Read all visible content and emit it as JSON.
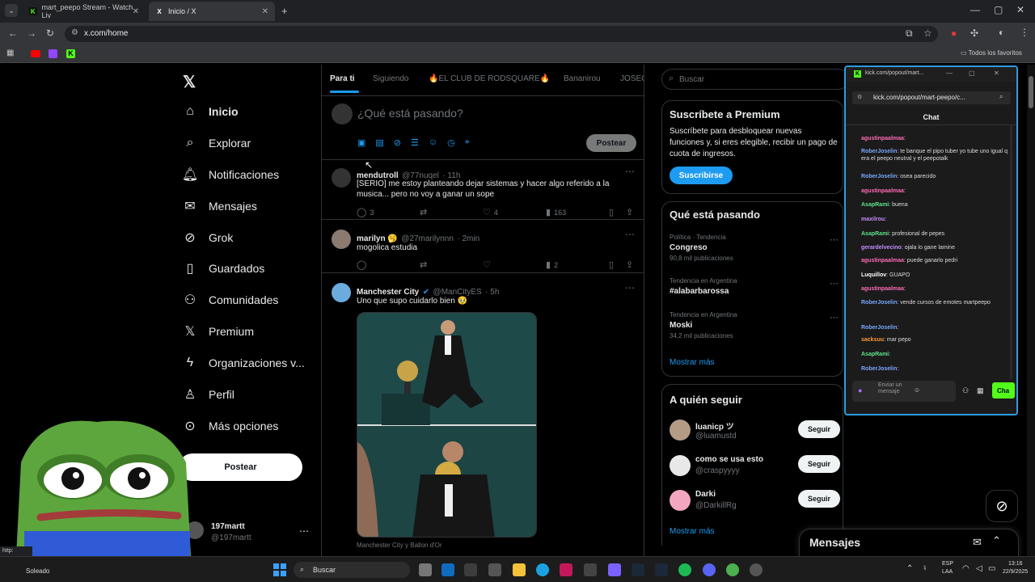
{
  "browser": {
    "tabs": [
      {
        "title": "mart_peepo Stream - Watch Liv",
        "favicon": "K",
        "favicon_color": "#53fc18"
      },
      {
        "title": "Inicio / X",
        "favicon": "X",
        "favicon_color": "#ffffff"
      }
    ],
    "url": "x.com/home",
    "bookmarks_label": "Todos los favoritos",
    "status_url": "http:"
  },
  "nav": {
    "items": [
      {
        "label": "Inicio",
        "icon": "home-icon"
      },
      {
        "label": "Explorar",
        "icon": "search-icon"
      },
      {
        "label": "Notificaciones",
        "icon": "bell-icon"
      },
      {
        "label": "Mensajes",
        "icon": "mail-icon"
      },
      {
        "label": "Grok",
        "icon": "grok-icon"
      },
      {
        "label": "Guardados",
        "icon": "bookmark-icon"
      },
      {
        "label": "Comunidades",
        "icon": "people-icon"
      },
      {
        "label": "Premium",
        "icon": "x-logo-icon"
      },
      {
        "label": "Organizaciones v...",
        "icon": "lightning-icon"
      },
      {
        "label": "Perfil",
        "icon": "person-icon"
      },
      {
        "label": "Más opciones",
        "icon": "more-circle-icon"
      }
    ],
    "post_button": "Postear",
    "account": {
      "name": "197martt",
      "handle": "@197martt"
    }
  },
  "feed": {
    "tabs": [
      "Para ti",
      "Siguiendo",
      "🔥EL CLUB DE RODSQUARE🔥",
      "Bananirou",
      "JOSEC"
    ],
    "compose_placeholder": "¿Qué está pasando?",
    "compose_post": "Postear",
    "tweets": [
      {
        "name": "mendutroll",
        "handle": "@77nuqel",
        "time": "· 11h",
        "text": "[SERIO] me estoy planteando dejar sistemas y hacer algo referido a la musica... pero no voy a ganar un sope",
        "replies": "3",
        "likes": "4",
        "views": "163"
      },
      {
        "name": "marilyn 🥱",
        "handle": "@27marilynnn",
        "time": "· 2min",
        "text": "mogolica estudia",
        "replies": "",
        "likes": "",
        "views": "2"
      },
      {
        "name": "Manchester City",
        "handle": "@ManCityES",
        "time": "· 5h",
        "text": "Uno que supo cuidarlo bien 🥹",
        "caption": "Manchester City y Ballon d'Or"
      }
    ]
  },
  "right": {
    "search_placeholder": "Buscar",
    "premium": {
      "title": "Suscríbete a Premium",
      "body": "Suscríbete para desbloquear nuevas funciones y, si eres elegible, recibir un pago de cuota de ingresos.",
      "button": "Suscribirse"
    },
    "trends": {
      "title": "Qué está pasando",
      "items": [
        {
          "context": "Política · Tendencia",
          "topic": "Congreso",
          "count": "90,8 mil publicaciones"
        },
        {
          "context": "Tendencia en Argentina",
          "topic": "#alabarbarossa",
          "count": ""
        },
        {
          "context": "Tendencia en Argentina",
          "topic": "Moski",
          "count": "34,2 mil publicaciones"
        }
      ],
      "more": "Mostrar más"
    },
    "follow": {
      "title": "A quién seguir",
      "items": [
        {
          "name": "luanicp ツ",
          "handle": "@luamustd",
          "button": "Seguir"
        },
        {
          "name": "como se usa esto",
          "handle": "@craspyyyy",
          "button": "Seguir"
        },
        {
          "name": "Darki",
          "handle": "@DarkillRg",
          "button": "Seguir"
        }
      ],
      "more": "Mostrar más"
    },
    "messages_drawer": "Mensajes"
  },
  "kick": {
    "window_title": "kick.com/popout/mart...",
    "url": "kick.com/popout/mart-peepo/c...",
    "header": "Chat",
    "lines": [
      {
        "user": "agustinpaalmaa",
        "color": "#ff6bb5",
        "msg": ":"
      },
      {
        "user": "RoberJoselin",
        "color": "#7aa7ff",
        "msg": ": te banque el pipo tuber yo tube uno igual q era el peepo neutral y el peepotalk"
      },
      {
        "user": "RoberJoselin",
        "color": "#7aa7ff",
        "msg": ": osea parecido"
      },
      {
        "user": "agustinpaalmaa",
        "color": "#ff6bb5",
        "msg": ":"
      },
      {
        "user": "AsapRami",
        "color": "#5ee38a",
        "msg": ": buena"
      },
      {
        "user": "maxilrou",
        "color": "#c78bff",
        "msg": ":"
      },
      {
        "user": "AsapRami",
        "color": "#5ee38a",
        "msg": ": profesional de pepes"
      },
      {
        "user": "gerardelvecino",
        "color": "#c78bff",
        "msg": ": ojala lo gane lamine"
      },
      {
        "user": "agustinpaalmaa",
        "color": "#ff6bb5",
        "msg": ": puede ganarlo pedri"
      },
      {
        "user": "Luquillov",
        "color": "#ffffff",
        "msg": ": GUAPO"
      },
      {
        "user": "agustinpaalmaa",
        "color": "#ff6bb5",
        "msg": ":"
      },
      {
        "user": "RoberJoselin",
        "color": "#7aa7ff",
        "msg": ": vende cursos de emotes martpeepo"
      },
      {
        "user": "RoberJoselin",
        "color": "#7aa7ff",
        "msg": ":"
      },
      {
        "user": "sacksuu",
        "color": "#ff9a3c",
        "msg": ": mar pepo"
      },
      {
        "user": "AsapRami",
        "color": "#5ee38a",
        "msg": ":"
      },
      {
        "user": "RoberJoselin",
        "color": "#7aa7ff",
        "msg": ":"
      }
    ],
    "input_placeholder": "Enviar un mensaje",
    "send": "Cha"
  },
  "taskbar": {
    "weather": "Soleado",
    "search": "Buscar",
    "lang": "ESP",
    "lang2": "LAA",
    "time": "13:16",
    "date": "22/9/2025"
  }
}
